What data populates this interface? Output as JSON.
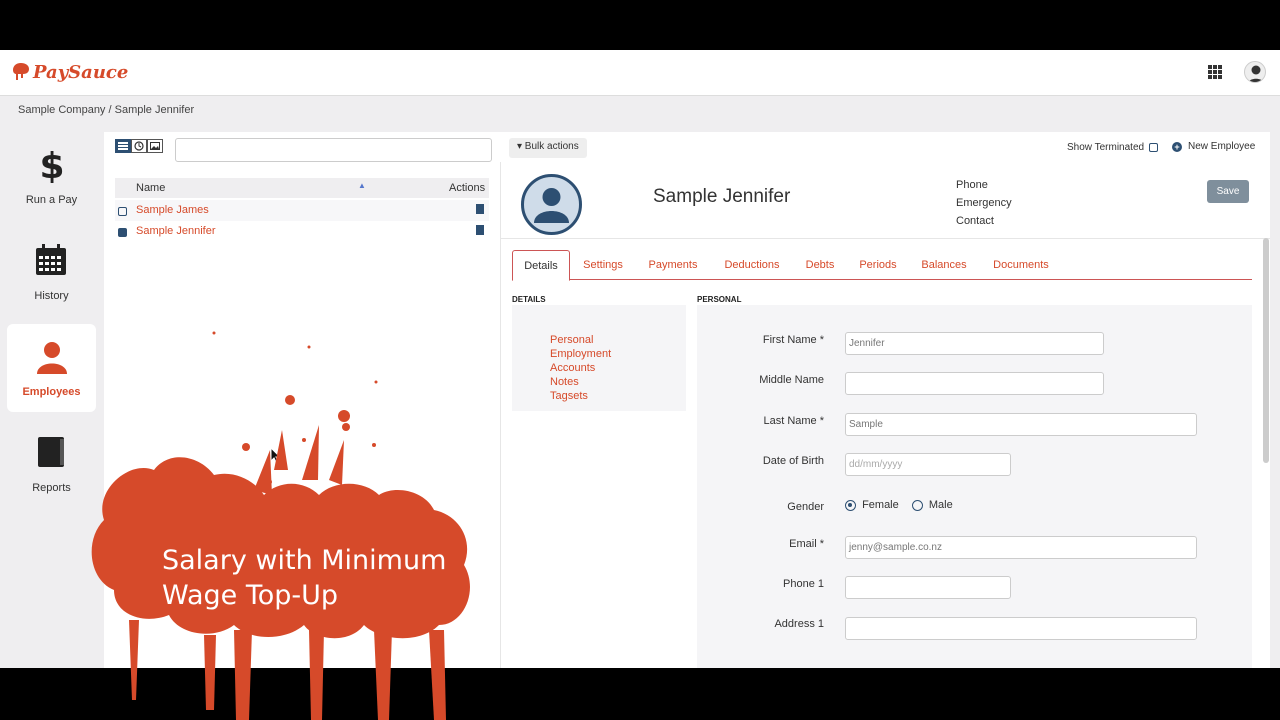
{
  "brand": {
    "name": "PaySauce",
    "accent": "#d64a2a",
    "dark": "#2d4f72"
  },
  "header": {
    "apps_icon": "apps-grid-icon",
    "user_icon": "user-avatar-icon"
  },
  "breadcrumb": {
    "company": "Sample Company",
    "sep": "/",
    "employee": "Sample Jennifer"
  },
  "sidebar": {
    "items": [
      {
        "label": "Run a Pay",
        "icon": "dollar-icon"
      },
      {
        "label": "History",
        "icon": "calendar-icon"
      },
      {
        "label": "Employees",
        "icon": "person-icon",
        "active": true
      },
      {
        "label": "Reports",
        "icon": "book-icon"
      }
    ]
  },
  "toolbar": {
    "bulk_actions": "▾ Bulk actions",
    "show_terminated": "Show Terminated",
    "new_employee": "New Employee"
  },
  "list": {
    "col_name": "Name",
    "col_actions": "Actions",
    "rows": [
      {
        "name": "Sample James",
        "selected": false
      },
      {
        "name": "Sample Jennifer",
        "selected": true
      }
    ]
  },
  "employee": {
    "name": "Sample Jennifer",
    "contact_labels": [
      "Phone",
      "Emergency",
      "Contact"
    ],
    "save": "Save"
  },
  "tabs": [
    "Details",
    "Settings",
    "Payments",
    "Deductions",
    "Debts",
    "Periods",
    "Balances",
    "Documents"
  ],
  "details": {
    "heading": "DETAILS",
    "links": [
      "Personal",
      "Employment",
      "Accounts",
      "Notes",
      "Tagsets"
    ]
  },
  "personal": {
    "heading": "PERSONAL",
    "first_name_label": "First Name *",
    "first_name": "Jennifer",
    "middle_name_label": "Middle Name",
    "last_name_label": "Last Name *",
    "last_name": "Sample",
    "dob_label": "Date of Birth",
    "dob_placeholder": "dd/mm/yyyy",
    "gender_label": "Gender",
    "gender_female": "Female",
    "gender_male": "Male",
    "gender_value": "Female",
    "email_label": "Email *",
    "email": "jenny@sample.co.nz",
    "phone_label": "Phone 1",
    "address_label": "Address 1"
  },
  "overlay": {
    "title": "Salary with Minimum Wage Top-Up",
    "title_line1": "Salary with Minimum",
    "title_line2": "Wage Top-Up"
  }
}
